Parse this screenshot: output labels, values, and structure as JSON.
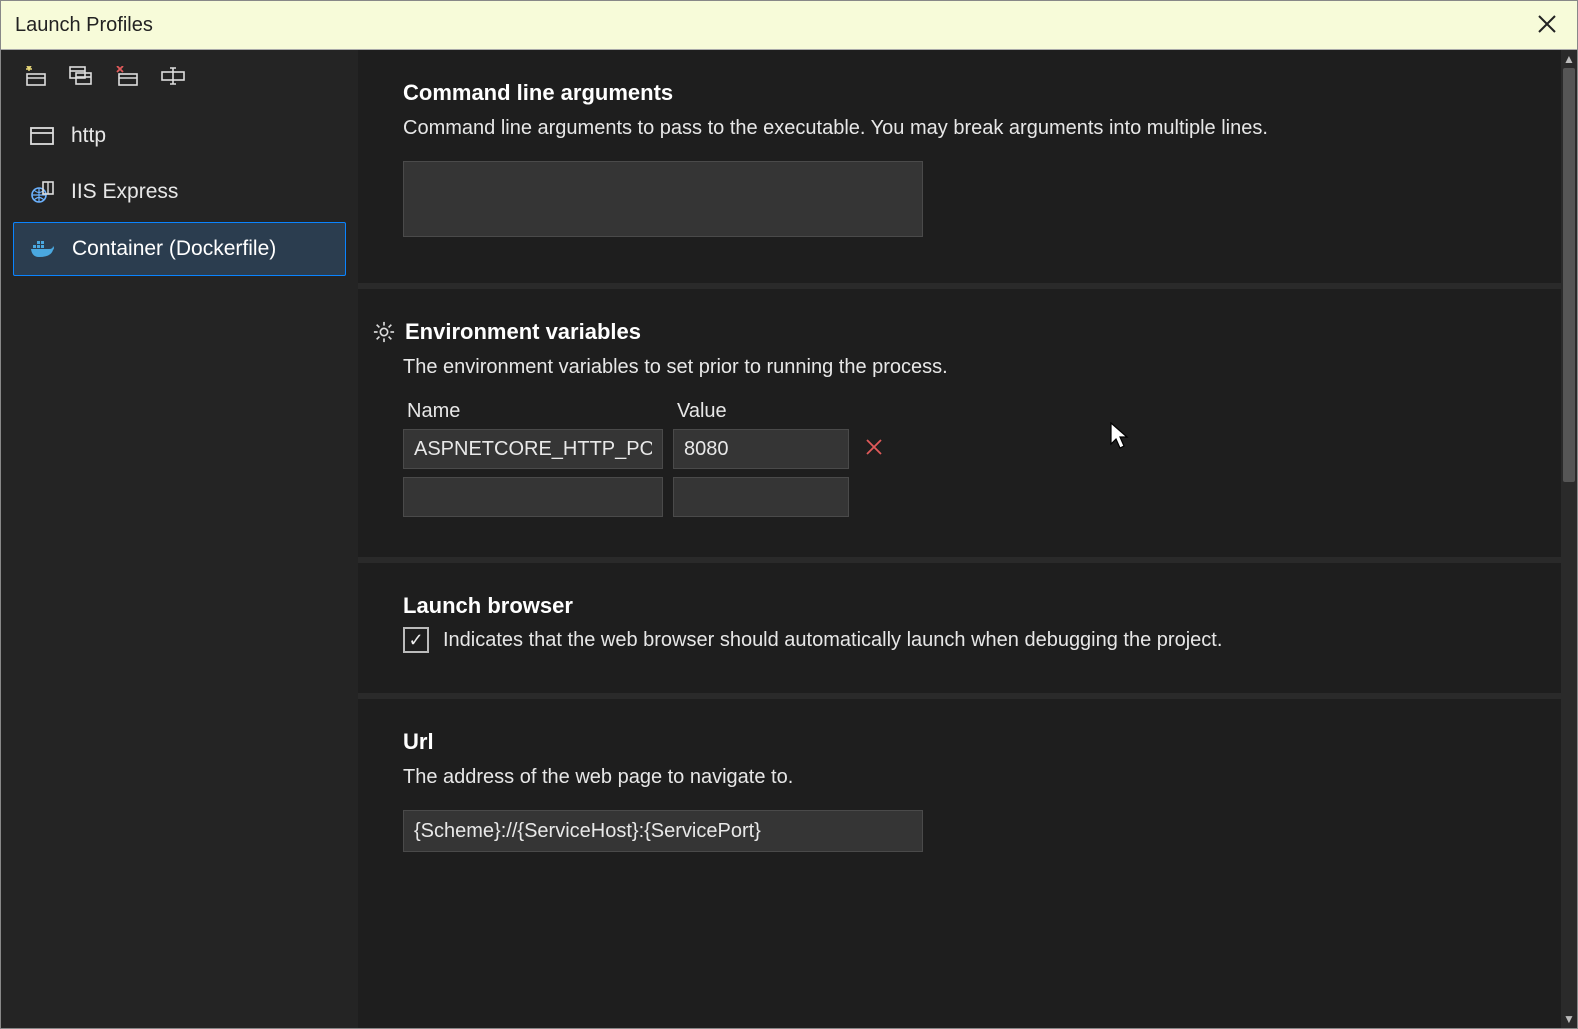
{
  "title": "Launch Profiles",
  "profiles": [
    {
      "label": "http",
      "icon": "window"
    },
    {
      "label": "IIS Express",
      "icon": "globe"
    },
    {
      "label": "Container (Dockerfile)",
      "icon": "docker"
    }
  ],
  "selected_profile_index": 2,
  "sections": {
    "cmdline": {
      "title": "Command line arguments",
      "desc": "Command line arguments to pass to the executable. You may break arguments into multiple lines.",
      "value": ""
    },
    "env": {
      "title": "Environment variables",
      "desc": "The environment variables to set prior to running the process.",
      "columns": {
        "name": "Name",
        "value": "Value"
      },
      "rows": [
        {
          "name": "ASPNETCORE_HTTP_PORTS",
          "value": "8080"
        },
        {
          "name": "",
          "value": ""
        }
      ]
    },
    "launch_browser": {
      "title": "Launch browser",
      "desc": "Indicates that the web browser should automatically launch when debugging the project.",
      "checked": true
    },
    "url": {
      "title": "Url",
      "desc": "The address of the web page to navigate to.",
      "value": "{Scheme}://{ServiceHost}:{ServicePort}"
    }
  }
}
